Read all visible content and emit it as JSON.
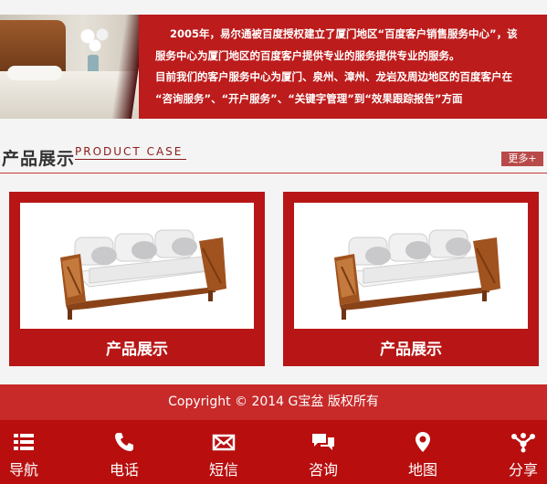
{
  "intro": {
    "lines": [
      "2005年，易尔通被百度授权建立了厦门地区“百度客户销售服务中心”，该",
      "服务中心为厦门地区的百度客户提供专业的服务提供专业的服务。",
      "目前我们的客户服务中心为厦门、泉州、漳州、龙岩及周边地区的百度客户在",
      "“咨询服务”、“开户服务”、“关键字管理”到“效果跟踪报告”方面"
    ]
  },
  "section": {
    "title_cn": "产品展示",
    "title_en": "PRODUCT CASE",
    "more_label": "更多+"
  },
  "products": [
    {
      "label": "产品展示"
    },
    {
      "label": "产品展示"
    }
  ],
  "footer": {
    "copyright": "Copyright © 2014 G宝盆 版权所有"
  },
  "nav": [
    {
      "label": "导航",
      "icon": "list-icon"
    },
    {
      "label": "电话",
      "icon": "phone-icon"
    },
    {
      "label": "短信",
      "icon": "envelope-icon"
    },
    {
      "label": "咨询",
      "icon": "chat-icon"
    },
    {
      "label": "地图",
      "icon": "map-pin-icon"
    },
    {
      "label": "分享",
      "icon": "share-icon"
    }
  ],
  "colors": {
    "brand_red": "#b81616",
    "footer_red": "#c82a2a",
    "nav_red": "#b80e0e"
  }
}
